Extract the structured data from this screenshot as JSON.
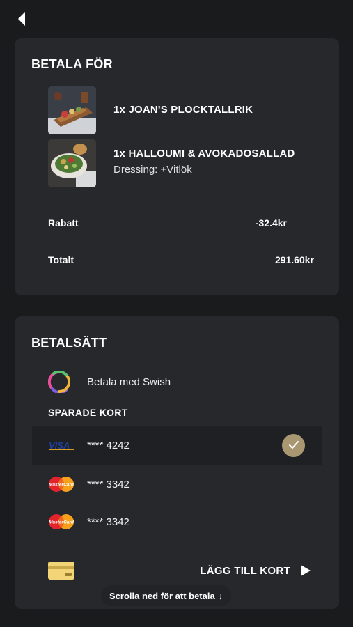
{
  "order": {
    "title": "BETALA FÖR",
    "items": [
      {
        "name": "1x JOAN'S PLOCKTALLRIK",
        "detail": ""
      },
      {
        "name": "1x HALLOUMI & AVOKADOSALLAD",
        "detail": "Dressing: +Vitlök"
      }
    ],
    "discount_label": "Rabatt",
    "discount_value": "-32.4kr",
    "total_label": "Totalt",
    "total_value": "291.60kr"
  },
  "payment": {
    "title": "BETALSÄTT",
    "swish_label": "Betala med Swish",
    "saved_cards_label": "SPARADE KORT",
    "cards": [
      {
        "brand": "VISA",
        "number": "**** 4242",
        "selected": true
      },
      {
        "brand": "MasterCard",
        "number": "**** 3342",
        "selected": false
      },
      {
        "brand": "MasterCard",
        "number": "**** 3342",
        "selected": false
      }
    ],
    "add_card_label": "LÄGG TILL KORT"
  },
  "scroll_hint": {
    "label": "Scrolla ned för att betala",
    "arrow": "↓"
  },
  "colors": {
    "background": "#1a1b1d",
    "card": "#27282c",
    "accent": "#a89770"
  },
  "icons": [
    "back-arrow-icon",
    "swish-icon",
    "visa-icon",
    "mastercard-icon",
    "credit-card-icon",
    "play-arrow-icon",
    "check-icon"
  ]
}
